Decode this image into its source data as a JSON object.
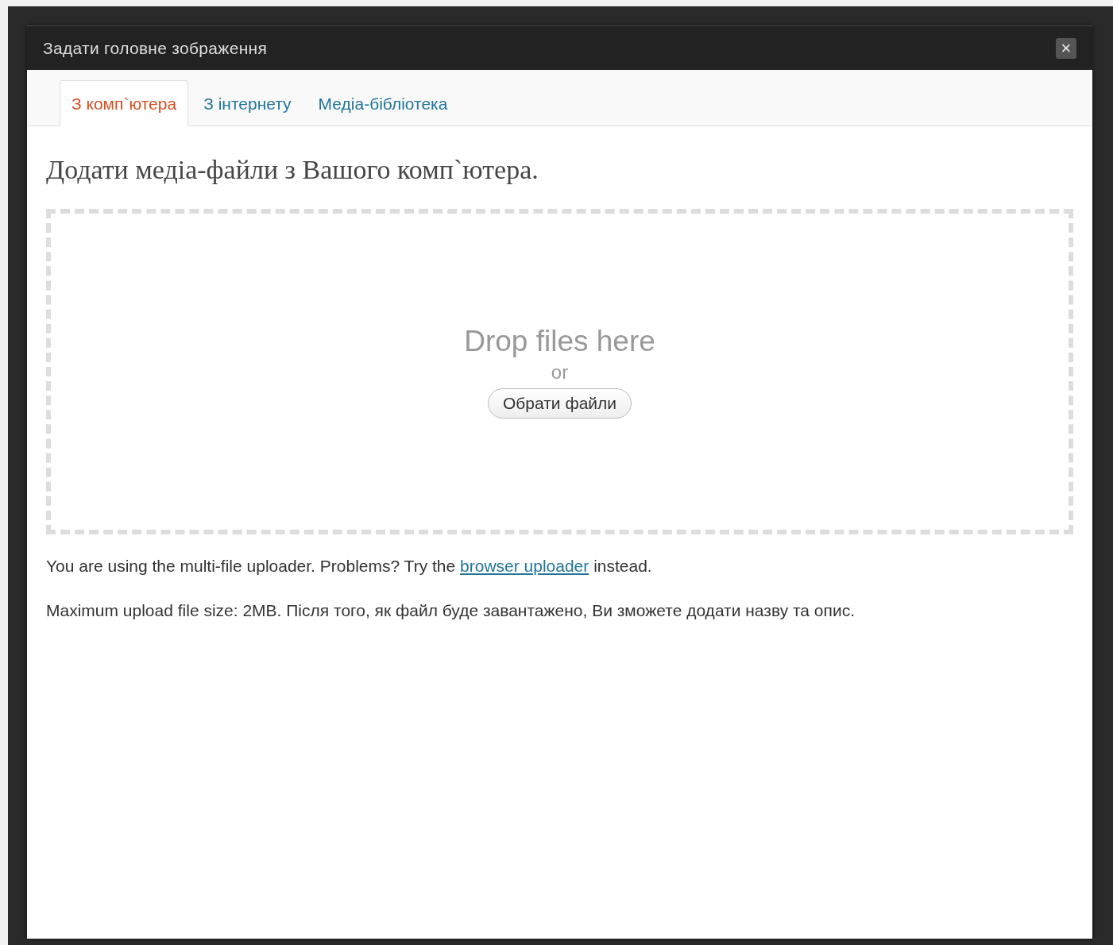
{
  "window": {
    "title": "Задати головне зображення",
    "close": "×"
  },
  "tabs": [
    {
      "label": "З комп`ютера",
      "selected": true
    },
    {
      "label": "З інтернету",
      "selected": false
    },
    {
      "label": "Медіа-бібліотека",
      "selected": false
    }
  ],
  "heading": "Додати медіа-файли з Вашого комп`ютера.",
  "dropzone": {
    "title": "Drop files here",
    "or": "or",
    "button": "Обрати файли"
  },
  "notice": {
    "before": "You are using the multi-file uploader. Problems? Try the",
    "link": "browser uploader",
    "after": "instead."
  },
  "max_size": "Maximum upload file size: 2MB. Після того, як файл буде завантажено, Ви зможете додати назву та опис."
}
